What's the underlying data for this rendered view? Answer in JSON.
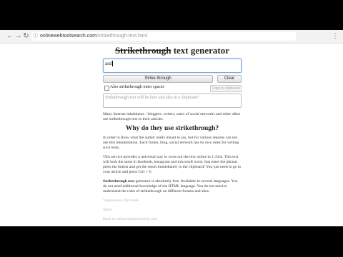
{
  "browser": {
    "address_domain": "onlinewebtoolsearch.com",
    "address_path": "/strikethrough-text.html",
    "back_icon": "arrow-left-icon",
    "forward_icon": "arrow-right-icon",
    "reload_icon": "reload-icon",
    "menu_icon": "menu-dots-icon"
  },
  "tool": {
    "title_strike": "Strikethrough",
    "title_rest": " text generator",
    "input_value": "asd",
    "strike_button": "Strike through",
    "clear_button": "Clear",
    "spaces_label": "Also strikethrough outer spaces",
    "copy_button": "Copy to clipboard",
    "output_placeholder": "Strikethrough text will be here and also in a clipboard!"
  },
  "content": {
    "intro": "Many Internet inhabitants - bloggers, writers, users of social networks and other often use strikethrough text in their articles.",
    "section_title": "Why do they use strikethrough?",
    "para1": "In order to show what the author really meant to say, but for various reasons can not use this interpretation. Each forum, blog, social network has its own rules for writing such texts.",
    "para2": "This service provides a universal way to cross out the text online in 1 click. This text will look the same in facebook, instagram and microsoft word. Just enter the phrase, press the button and get the result immediately in the clipboard! You just need to go to your article and press Ctrl + V.",
    "para3_bold": "Strikethrough text",
    "para3_rest": " generator is absolutely free. Available in several languages. You do not need additional knowledge of the HTML language. You do not need to understand the rules of strikethrough on different forums and sites.",
    "lang_links": "Українська | Русский",
    "share_link": "Share",
    "back_link": "Back to onlinewebtoolsearch.com"
  }
}
